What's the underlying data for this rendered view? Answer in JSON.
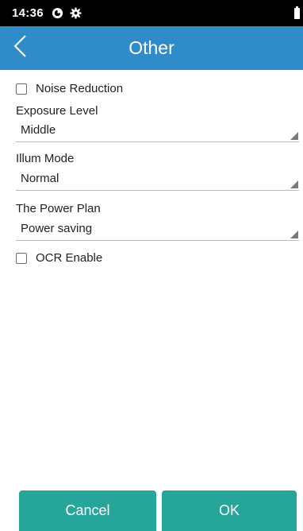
{
  "status_bar": {
    "time": "14:36",
    "icons": [
      "data-saver-icon",
      "settings-gear-icon",
      "battery-icon"
    ]
  },
  "app_bar": {
    "title": "Other",
    "back_icon": "chevron-left-icon",
    "color": "#2f8cc9"
  },
  "form": {
    "noise_reduction": {
      "label": "Noise Reduction",
      "checked": false
    },
    "exposure_level": {
      "label": "Exposure Level",
      "value": "Middle"
    },
    "illum_mode": {
      "label": "Illum Mode",
      "value": "Normal"
    },
    "power_plan": {
      "label": "The Power Plan",
      "value": "Power saving"
    },
    "ocr_enable": {
      "label": "OCR Enable",
      "checked": false
    }
  },
  "buttons": {
    "cancel_label": "Cancel",
    "ok_label": "OK",
    "color": "#26a69a"
  }
}
